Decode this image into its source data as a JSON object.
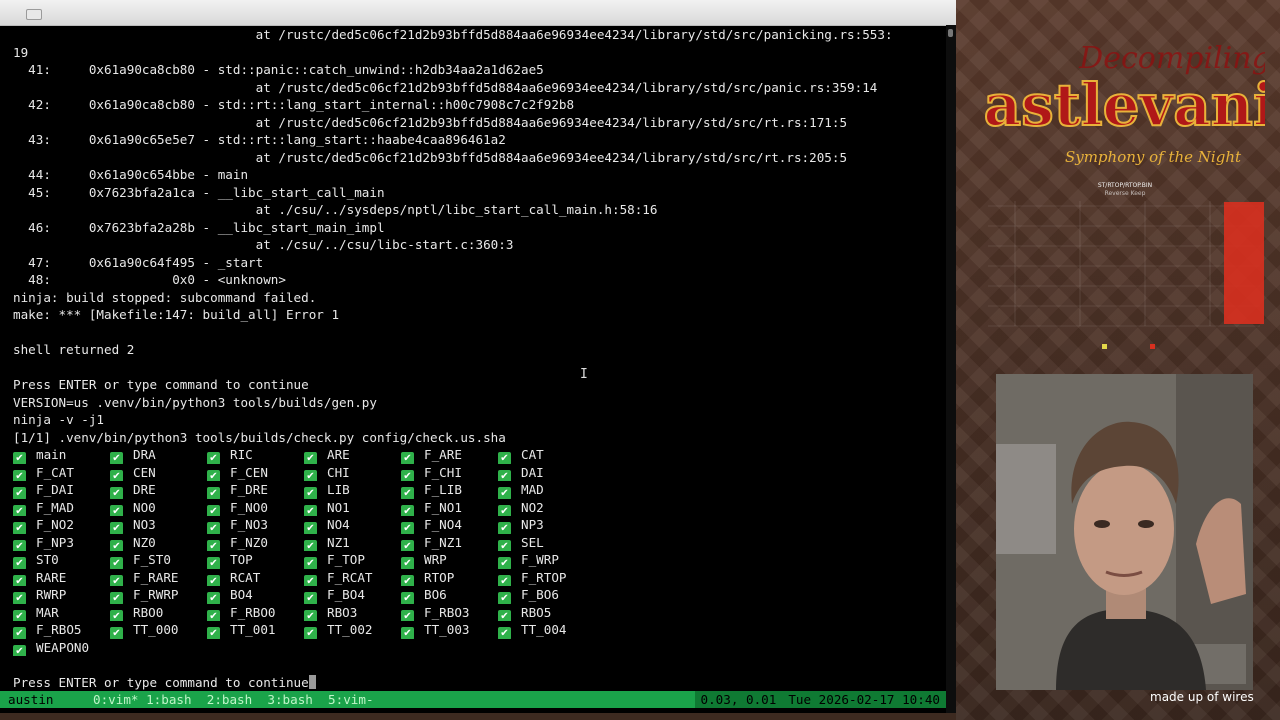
{
  "terminal": {
    "lines": [
      "                                at /rustc/ded5c06cf21d2b93bffd5d884aa6e96934ee4234/library/std/src/panicking.rs:553:",
      "19",
      "  41:     0x61a90ca8cb80 - std::panic::catch_unwind::h2db34aa2a1d62ae5",
      "                                at /rustc/ded5c06cf21d2b93bffd5d884aa6e96934ee4234/library/std/src/panic.rs:359:14",
      "  42:     0x61a90ca8cb80 - std::rt::lang_start_internal::h00c7908c7c2f92b8",
      "                                at /rustc/ded5c06cf21d2b93bffd5d884aa6e96934ee4234/library/std/src/rt.rs:171:5",
      "  43:     0x61a90c65e5e7 - std::rt::lang_start::haabe4caa896461a2",
      "                                at /rustc/ded5c06cf21d2b93bffd5d884aa6e96934ee4234/library/std/src/rt.rs:205:5",
      "  44:     0x61a90c654bbe - main",
      "  45:     0x7623bfa2a1ca - __libc_start_call_main",
      "                                at ./csu/../sysdeps/nptl/libc_start_call_main.h:58:16",
      "  46:     0x7623bfa2a28b - __libc_start_main_impl",
      "                                at ./csu/../csu/libc-start.c:360:3",
      "  47:     0x61a90c64f495 - _start",
      "  48:                0x0 - <unknown>",
      "ninja: build stopped: subcommand failed.",
      "make: *** [Makefile:147: build_all] Error 1",
      "",
      "shell returned 2",
      "",
      "Press ENTER or type command to continue",
      "VERSION=us .venv/bin/python3 tools/builds/gen.py",
      "ninja -v -j1",
      "[1/1] .venv/bin/python3 tools/builds/check.py config/check.us.sha"
    ],
    "check_mark": "✔",
    "check_rows": [
      [
        "main",
        "DRA",
        "RIC",
        "ARE",
        "F_ARE",
        "CAT"
      ],
      [
        "F_CAT",
        "CEN",
        "F_CEN",
        "CHI",
        "F_CHI",
        "DAI"
      ],
      [
        "F_DAI",
        "DRE",
        "F_DRE",
        "LIB",
        "F_LIB",
        "MAD"
      ],
      [
        "F_MAD",
        "NO0",
        "F_NO0",
        "NO1",
        "F_NO1",
        "NO2"
      ],
      [
        "F_NO2",
        "NO3",
        "F_NO3",
        "NO4",
        "F_NO4",
        "NP3"
      ],
      [
        "F_NP3",
        "NZ0",
        "F_NZ0",
        "NZ1",
        "F_NZ1",
        "SEL"
      ],
      [
        "ST0",
        "F_ST0",
        "TOP",
        "F_TOP",
        "WRP",
        "F_WRP"
      ],
      [
        "RARE",
        "F_RARE",
        "RCAT",
        "F_RCAT",
        "RTOP",
        "F_RTOP"
      ],
      [
        "RWRP",
        "F_RWRP",
        "BO4",
        "F_BO4",
        "BO6",
        "F_BO6"
      ],
      [
        "MAR",
        "RBO0",
        "F_RBO0",
        "RBO3",
        "F_RBO3",
        "RBO5"
      ],
      [
        "F_RBO5",
        "TT_000",
        "TT_001",
        "TT_002",
        "TT_003",
        "TT_004"
      ],
      [
        "WEAPON0"
      ]
    ],
    "prompt": "Press ENTER or type command to continue"
  },
  "statusbar": {
    "session": "austin",
    "windows": "0:vim* 1:bash  2:bash  3:bash  5:vim-",
    "load": "0.03, 0.01",
    "datetime": "Tue 2026-02-17 10:40"
  },
  "overlay": {
    "logo_line1": "Decompiling",
    "logo_line2": "Castlevania",
    "logo_line3": "Symphony of the Night",
    "logo_sub1": "ST/RTOP/RTOP.BIN",
    "logo_sub2": "Reverse Keep",
    "caption": "made up of wires"
  },
  "colors": {
    "terminal_bg": "#000000",
    "terminal_fg": "#e8e8e8",
    "check_green": "#2fb14a",
    "status_green": "#1aa34a",
    "logo_red": "#b01818",
    "logo_gold": "#e8b23a"
  }
}
